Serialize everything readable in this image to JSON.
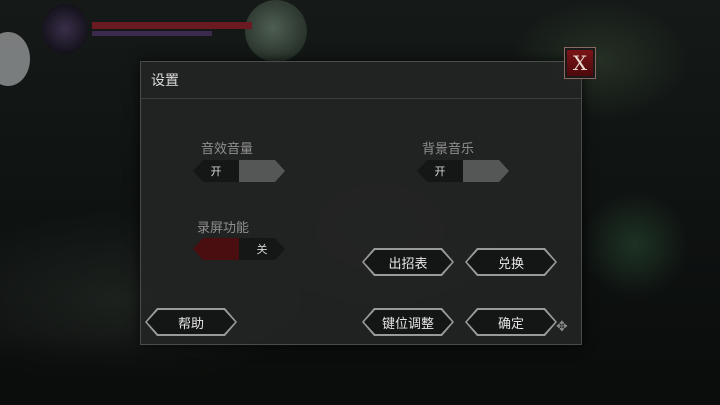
{
  "dialog": {
    "title": "设置",
    "close_label": "X"
  },
  "settings": {
    "sound_effects": {
      "label": "音效音量",
      "on_label": "开",
      "off_label": "",
      "state": "on"
    },
    "background_music": {
      "label": "背景音乐",
      "on_label": "开",
      "off_label": "",
      "state": "on"
    },
    "screen_record": {
      "label": "录屏功能",
      "on_label": "",
      "off_label": "关",
      "state": "off"
    }
  },
  "buttons": {
    "moves_list": "出招表",
    "redeem": "兑换",
    "help": "帮助",
    "key_config": "键位调整",
    "confirm": "确定"
  },
  "colors": {
    "close_button": "#7a1416",
    "toggle_off_active": "#4a0e10",
    "panel": "#222424"
  }
}
